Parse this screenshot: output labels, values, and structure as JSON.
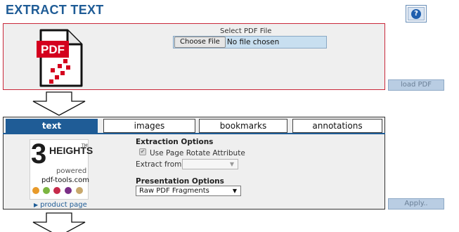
{
  "title": "EXTRACT TEXT",
  "help_glyph": "?",
  "file": {
    "select_label": "Select PDF File",
    "choose_button": "Choose File",
    "status": "No file chosen",
    "pdf_badge": "PDF"
  },
  "load_button": "load PDF",
  "tabs": [
    {
      "label": "text",
      "active": true
    },
    {
      "label": "images",
      "active": false
    },
    {
      "label": "bookmarks",
      "active": false
    },
    {
      "label": "annotations",
      "active": false
    }
  ],
  "logo": {
    "number": "3",
    "word": "HEIGHTS",
    "tm": "TM",
    "powered": "powered",
    "site": "pdf-tools.com",
    "dot_colors": [
      "#e89a2a",
      "#7bb540",
      "#c62a4a",
      "#7a2e86",
      "#c8a86c"
    ]
  },
  "product_link": "product page",
  "extraction": {
    "title": "Extraction Options",
    "rotate_label": "Use Page Rotate Attribute",
    "rotate_checked": true,
    "extract_from_label": "Extract from",
    "extract_from_value": ""
  },
  "presentation": {
    "title": "Presentation Options",
    "selected": "Raw PDF Fragments"
  },
  "apply_button": "Apply..",
  "colors": {
    "accent": "#1f5c96",
    "panel_border_red": "#c9283a",
    "disabled_button": "#b9cde3"
  }
}
